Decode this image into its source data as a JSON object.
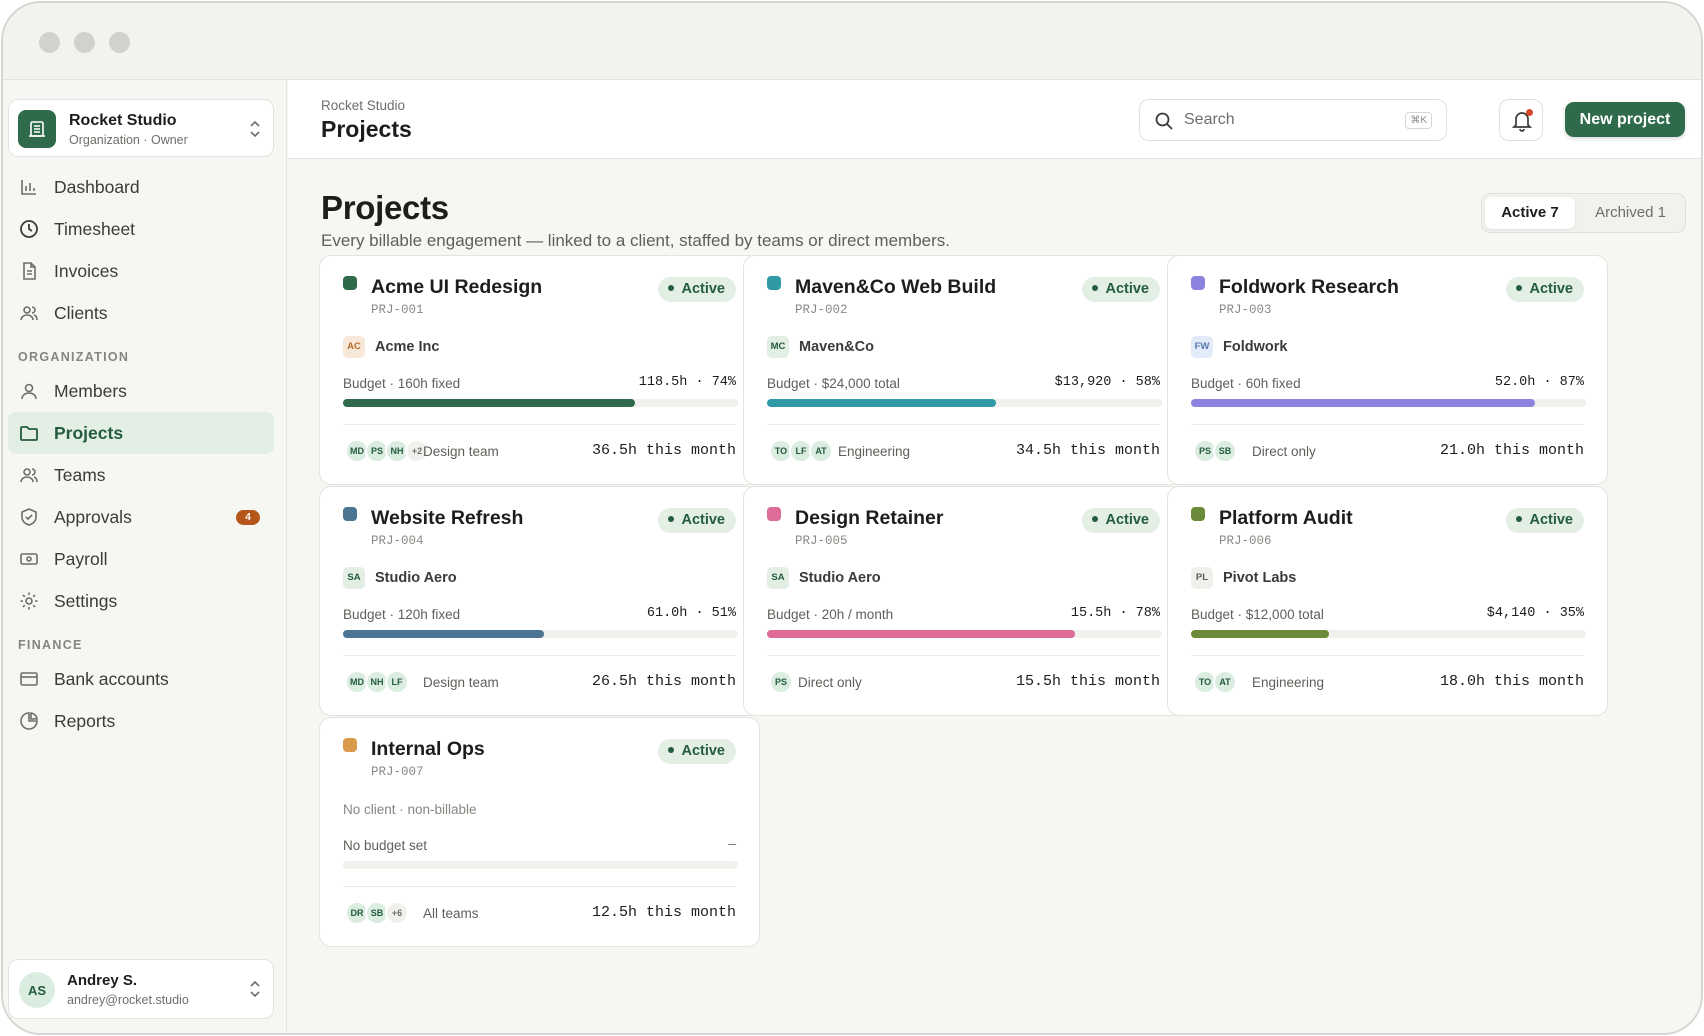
{
  "sidebar": {
    "org": {
      "name": "Rocket Studio",
      "sub": "Organization · Owner"
    },
    "items": [
      {
        "label": "Dashboard",
        "icon": "bar-chart-icon"
      },
      {
        "label": "Timesheet",
        "icon": "clock-icon"
      },
      {
        "label": "Invoices",
        "icon": "document-icon"
      },
      {
        "label": "Clients",
        "icon": "users-icon"
      }
    ],
    "org_section": "ORGANIZATION",
    "org_items": [
      {
        "label": "Members",
        "icon": "user-icon"
      },
      {
        "label": "Projects",
        "icon": "folder-icon",
        "active": true
      },
      {
        "label": "Teams",
        "icon": "team-icon"
      },
      {
        "label": "Approvals",
        "icon": "shield-check-icon",
        "badge": "4"
      },
      {
        "label": "Payroll",
        "icon": "banknote-icon"
      },
      {
        "label": "Settings",
        "icon": "gear-icon"
      }
    ],
    "finance_section": "FINANCE",
    "finance_items": [
      {
        "label": "Bank accounts",
        "icon": "card-icon"
      },
      {
        "label": "Reports",
        "icon": "pie-chart-icon"
      }
    ],
    "user": {
      "initials": "AS",
      "name": "Andrey S.",
      "email": "andrey@rocket.studio"
    }
  },
  "topbar": {
    "breadcrumb": "Rocket Studio",
    "title": "Projects",
    "search_placeholder": "Search",
    "search_shortcut": "⌘K",
    "new_project": "New project"
  },
  "main": {
    "title": "Projects",
    "subtitle": "Every billable engagement — linked to a client, staffed by teams or direct members.",
    "tabs": {
      "active": "Active 7",
      "archived": "Archived 1"
    }
  },
  "colors": {
    "accent": "#2f6b4a",
    "acme": "#2f6b4a",
    "maven": "#2f9aa6",
    "foldwork": "#8b82e0",
    "website": "#4b7592",
    "design": "#df6b99",
    "platform": "#6b8a3a",
    "internal": "#d99b4b"
  },
  "projects": [
    {
      "title": "Acme UI Redesign",
      "id": "PRJ-001",
      "status": "Active",
      "client_initials": "AC",
      "client": "Acme Inc",
      "budget_label": "Budget · 160h fixed",
      "budget_value": "118.5h · 74%",
      "progress": 0.74,
      "avatars": [
        "MD",
        "PS",
        "NH",
        "+2"
      ],
      "team": "Design team",
      "month": "36.5h this month"
    },
    {
      "title": "Maven&Co Web Build",
      "id": "PRJ-002",
      "status": "Active",
      "client_initials": "MC",
      "client": "Maven&Co",
      "budget_label": "Budget · $24,000 total",
      "budget_value": "$13,920 · 58%",
      "progress": 0.58,
      "avatars": [
        "TO",
        "LF",
        "AT"
      ],
      "team": "Engineering",
      "month": "34.5h this month"
    },
    {
      "title": "Foldwork Research",
      "id": "PRJ-003",
      "status": "Active",
      "client_initials": "FW",
      "client": "Foldwork",
      "budget_label": "Budget · 60h fixed",
      "budget_value": "52.0h · 87%",
      "progress": 0.87,
      "avatars": [
        "PS",
        "SB"
      ],
      "team": "Direct only",
      "month": "21.0h this month"
    },
    {
      "title": "Website Refresh",
      "id": "PRJ-004",
      "status": "Active",
      "client_initials": "SA",
      "client": "Studio Aero",
      "budget_label": "Budget · 120h fixed",
      "budget_value": "61.0h · 51%",
      "progress": 0.51,
      "avatars": [
        "MD",
        "NH",
        "LF"
      ],
      "team": "Design team",
      "month": "26.5h this month"
    },
    {
      "title": "Design Retainer",
      "id": "PRJ-005",
      "status": "Active",
      "client_initials": "SA",
      "client": "Studio Aero",
      "budget_label": "Budget · 20h / month",
      "budget_value": "15.5h · 78%",
      "progress": 0.78,
      "avatars": [
        "PS"
      ],
      "team": "Direct only",
      "month": "15.5h this month"
    },
    {
      "title": "Platform Audit",
      "id": "PRJ-006",
      "status": "Active",
      "client_initials": "PL",
      "client": "Pivot Labs",
      "budget_label": "Budget · $12,000 total",
      "budget_value": "$4,140 · 35%",
      "progress": 0.35,
      "avatars": [
        "TO",
        "AT"
      ],
      "team": "Engineering",
      "month": "18.0h this month"
    },
    {
      "title": "Internal Ops",
      "id": "PRJ-007",
      "status": "Active",
      "no_client": "No client · non-billable",
      "budget_label": "No budget set",
      "budget_value": "–",
      "progress": 0,
      "avatars": [
        "DR",
        "SB",
        "+6"
      ],
      "team": "All teams",
      "month": "12.5h this month"
    }
  ]
}
